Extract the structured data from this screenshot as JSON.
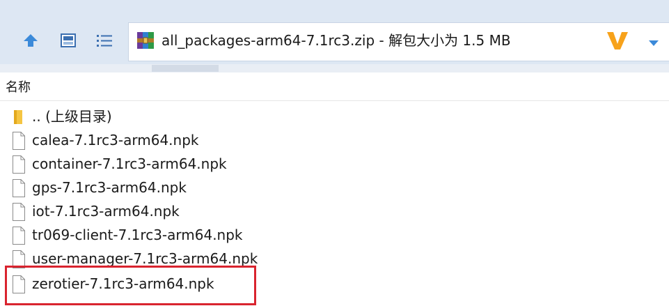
{
  "address_bar": {
    "path": "all_packages-arm64-7.1rc3.zip - 解包大小为 1.5 MB",
    "archive_icon": "winrar-archive-icon"
  },
  "toolbar": {
    "up_icon": "up-arrow-icon",
    "view_icon": "details-view-icon",
    "list_icon": "list-view-icon",
    "brand_icon": "v-logo-icon",
    "dropdown_icon": "chevron-down-icon"
  },
  "columns": {
    "name": "名称"
  },
  "files": [
    {
      "name": ".. (上级目录)",
      "icon": "folder-icon"
    },
    {
      "name": "calea-7.1rc3-arm64.npk",
      "icon": "file-icon"
    },
    {
      "name": "container-7.1rc3-arm64.npk",
      "icon": "file-icon"
    },
    {
      "name": "gps-7.1rc3-arm64.npk",
      "icon": "file-icon"
    },
    {
      "name": "iot-7.1rc3-arm64.npk",
      "icon": "file-icon"
    },
    {
      "name": "tr069-client-7.1rc3-arm64.npk",
      "icon": "file-icon"
    },
    {
      "name": "user-manager-7.1rc3-arm64.npk",
      "icon": "file-icon"
    },
    {
      "name": "zerotier-7.1rc3-arm64.npk",
      "icon": "file-icon"
    }
  ],
  "highlight": {
    "color": "#d9232e",
    "target": "zerotier-7.1rc3-arm64.npk"
  },
  "colors": {
    "toolbar_bg": "#dde7f3",
    "icon_blue": "#3b8ad9",
    "logo_orange": "#f7a21b"
  }
}
